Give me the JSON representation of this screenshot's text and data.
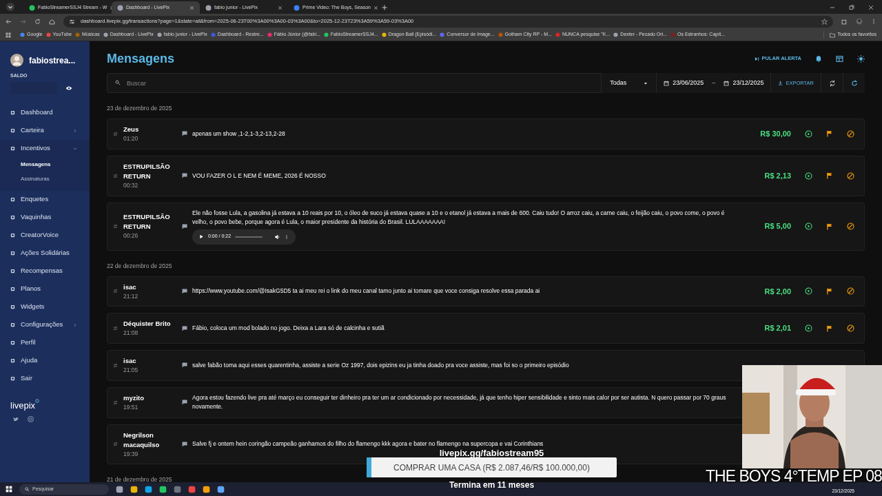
{
  "browser": {
    "tabs": [
      {
        "title": "FabioStreamerSSJ4 Stream - W",
        "selected": false
      },
      {
        "title": "Dashboard - LivePix",
        "selected": true
      },
      {
        "title": "fabio junior - LivePix",
        "selected": false
      },
      {
        "title": "Prime Video: The Boys, Season",
        "selected": false
      }
    ],
    "url": "dashboard.livepix.gg/transactions?page=1&state=all&from=2025-06-23T00%3A00%3A00-03%3A00&to=2025-12-23T23%3A59%3A59-03%3A00",
    "bookmarks": [
      "Google",
      "YouTube",
      "Músicas",
      "Dashboard - LivePix",
      "fabio junior - LivePix",
      "Dashboard - Restre...",
      "Fábio Júnior (@fabi...",
      "FabioStreamerSSJ4...",
      "Dragon Ball (Episódi...",
      "Conversor de Image...",
      "Gotham City RP - M...",
      "NUNCA pesquise \"K...",
      "Dexter - Pecado Ori...",
      "Os Estranhos: Capít..."
    ],
    "all_bookmarks": "Todos os favoritos"
  },
  "sidebar": {
    "user": "fabiostrea...",
    "balance_label": "SALDO",
    "items": [
      {
        "label": "Dashboard",
        "selected": false
      },
      {
        "label": "Carteira",
        "selected": false,
        "expanded": false
      },
      {
        "label": "Incentivos",
        "selected": false,
        "expanded": true,
        "children": [
          {
            "label": "Mensagens",
            "selected": true
          },
          {
            "label": "Assinaturas",
            "selected": false
          }
        ]
      },
      {
        "label": "Enquetes",
        "selected": false
      },
      {
        "label": "Vaquinhas",
        "selected": false
      },
      {
        "label": "CreatorVoice",
        "selected": false
      },
      {
        "label": "Ações Solidárias",
        "selected": false
      },
      {
        "label": "Recompensas",
        "selected": false
      },
      {
        "label": "Planos",
        "selected": false
      },
      {
        "label": "Widgets",
        "selected": false
      },
      {
        "label": "Configurações",
        "selected": false,
        "expanded": false
      },
      {
        "label": "Perfil",
        "selected": false
      },
      {
        "label": "Ajuda",
        "selected": false
      },
      {
        "label": "Sair",
        "selected": false
      }
    ],
    "logo": "livepix"
  },
  "header": {
    "title": "Mensagens",
    "skip_alert": "PULAR ALERTA"
  },
  "filters": {
    "search_placeholder": "Buscar",
    "status": "Todas",
    "date_from": "23/06/2025",
    "date_separator": "–",
    "date_to": "23/12/2025",
    "export": "EXPORTAR"
  },
  "groups": [
    {
      "date": "23 de dezembro de 2025",
      "messages": [
        {
          "name": "Zeus",
          "time": "01:20",
          "text": "apenas um show ,1-2,1-3,2-13,2-28",
          "amount": "R$ 30,00"
        },
        {
          "name": "ESTRUPILSÃO RETURN",
          "time": "00:32",
          "text": "VOU FAZER O L E NEM É MEME, 2026 É NOSSO",
          "amount": "R$ 2,13"
        },
        {
          "name": "ESTRUPILSÃO RETURN",
          "time": "00:26",
          "text": "Ele não fosse Lula, a gasolina já estava a 10 reais por 10, o óleo de suco já estava quase a 10 e o etanol já estava a mais de 600. Caiu tudo! O arroz caiu, a carne caiu, o feijão caiu, o povo come, o povo é velho, o povo bebe, porque agora é Lula, o maior presidente da história do Brasil. LULAAAAAAA!",
          "audio": "0:00 / 0:22",
          "amount": "R$ 5,00"
        }
      ]
    },
    {
      "date": "22 de dezembro de 2025",
      "messages": [
        {
          "name": "isac",
          "time": "21:12",
          "text": "https://www.youtube.com/@IsakG5D5 ta ai meu rei o link do meu canal tamo junto ai tomare que voce consiga resolve essa parada ai",
          "amount": "R$ 2,00"
        },
        {
          "name": "Déquister Brito",
          "time": "21:08",
          "text": "Fábio, coloca um mod bolado no jogo. Deixa a Lara só de calcinha e sutiã",
          "amount": "R$ 2,01"
        },
        {
          "name": "isac",
          "time": "21:05",
          "text": "salve fabão toma aqui esses quarentinha, assiste a serie Oz 1997, dois epizins eu ja tinha doado pra voce assiste, mas foi so o primeiro episódio"
        },
        {
          "name": "myzito",
          "time": "19:51",
          "text": "Agora estou fazendo live pra até março eu conseguir ter dinheiro pra ter um ar condicionado por necessidade, já que tenho hiper sensibilidade e sinto mais calor por ser autista. N quero passar por 70 graus novamente."
        },
        {
          "name": "Negrilson macaquilso",
          "time": "19:39",
          "text": "Salve fj e ontem hein coringão campeão ganhamos do filho do flamengo kkk agora e bater no flamengo na supercopa e vai Corinthians"
        }
      ]
    },
    {
      "date": "21 de dezembro de 2025"
    }
  ],
  "overlay": {
    "url": "livepix.gg/fabiostream95",
    "goal": "COMPRAR UMA CASA (R$ 2.087,46/R$ 100.000,00)",
    "level": 0.02,
    "remaining": "Termina em 11 meses",
    "caption": "THE BOYS 4°TEMP EP 08"
  },
  "taskbar": {
    "search_placeholder": "Pesquisar",
    "date": "23/12/2025"
  }
}
